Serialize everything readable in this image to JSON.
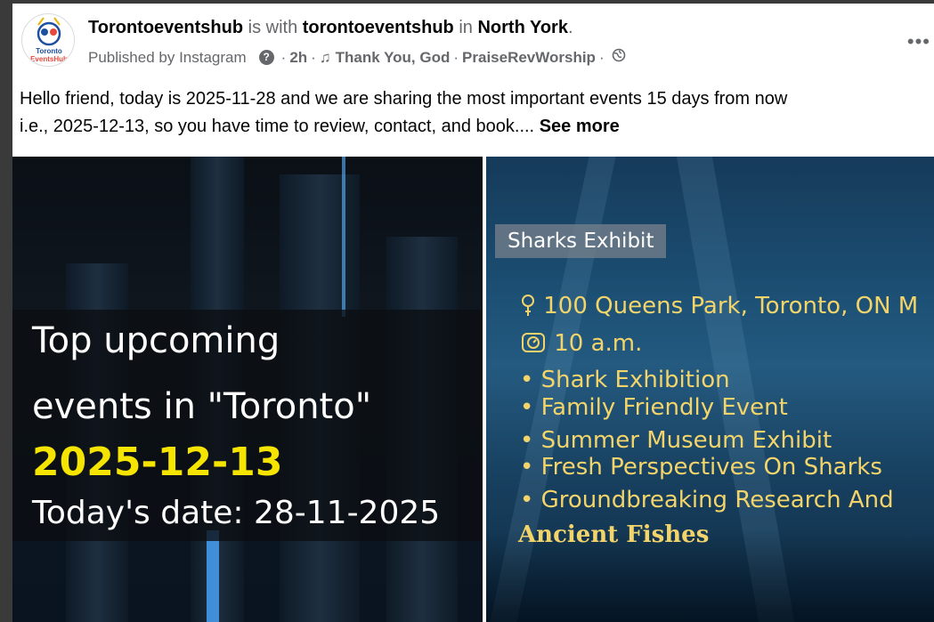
{
  "post": {
    "author": "Torontoeventshub",
    "is_with_word": "is with",
    "with_user": "torontoeventshub",
    "in_word": "in",
    "location": "North York",
    "period": ".",
    "published_by": "Published by Instagram",
    "time_ago": "2h",
    "song": "Thank You, God",
    "artist": "PraiseRevWorship",
    "separator": "·",
    "text_line1": "Hello friend, today is 2025-11-28 and we are sharing the most important events 15 days from now",
    "text_line2": "i.e., 2025-12-13, so you have time to review, contact, and book....",
    "see_more": "See more",
    "avatar_text_top": "Toronto",
    "avatar_text_bottom": "EventsHub"
  },
  "left_image": {
    "line1": "Top upcoming",
    "line2": "events in \"Toronto\"",
    "date": "2025-12-13",
    "today": "Today's date: 28-11-2025"
  },
  "right_image": {
    "tag": "Sharks Exhibit",
    "address": "100 Queens Park, Toronto, ON M",
    "time": "10 a.m.",
    "bullets": [
      "• Shark Exhibition",
      "• Family Friendly Event",
      "• Summer Museum Exhibit",
      "• Fresh Perspectives On Sharks",
      "• Groundbreaking Research And"
    ],
    "tail": "Ancient Fishes"
  },
  "icons": {
    "more": "more-options-icon",
    "help": "question-icon",
    "music": "music-note-icon",
    "globe": "globe-icon",
    "pin": "location-pin-icon",
    "clock": "alarm-clock-icon"
  },
  "colors": {
    "accent_yellow": "#f5e400",
    "text_yellow": "#f2d46a",
    "meta_gray": "#65676b"
  }
}
